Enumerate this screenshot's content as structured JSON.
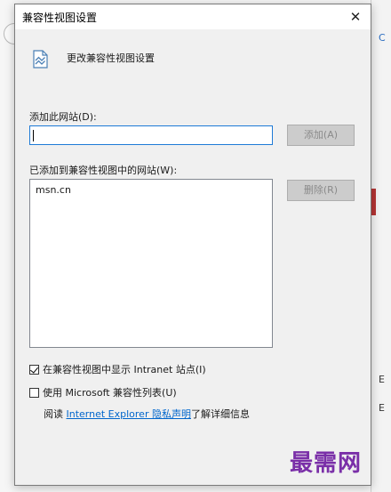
{
  "dialog": {
    "title": "兼容性视图设置",
    "close_glyph": "✕",
    "header_title": "更改兼容性视图设置"
  },
  "add_site": {
    "label": "添加此网站(D):",
    "value": "",
    "button": "添加(A)"
  },
  "added_sites": {
    "label": "已添加到兼容性视图中的网站(W):",
    "items": [
      "msn.cn"
    ],
    "remove_button": "删除(R)"
  },
  "options": [
    {
      "label": "在兼容性视图中显示 Intranet 站点(I)",
      "checked": true
    },
    {
      "label": "使用 Microsoft 兼容性列表(U)",
      "checked": false
    }
  ],
  "info": {
    "prefix": "阅读 ",
    "link": "Internet Explorer 隐私声明",
    "suffix": "了解详细信息"
  },
  "watermark": "最需网",
  "background": {
    "right_marks": [
      "C",
      "E",
      "E"
    ]
  }
}
